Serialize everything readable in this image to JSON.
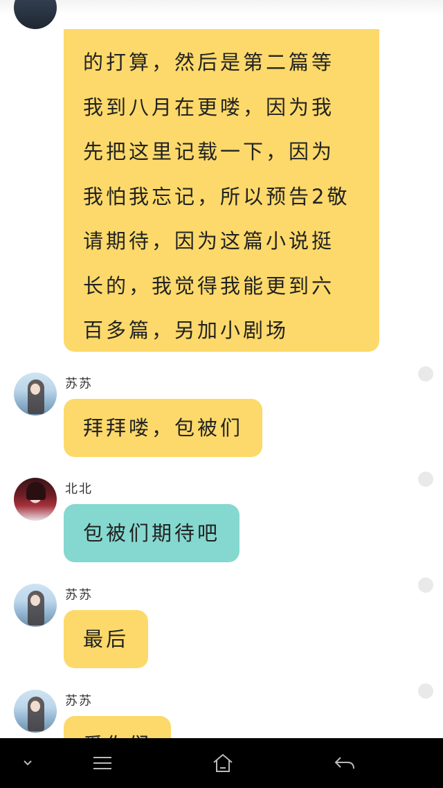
{
  "messages": [
    {
      "sender": "",
      "bubble_color": "#fcd96a",
      "lines": [
        "的打算，然后是第二篇等",
        "我到八月在更喽，因为我",
        "先把这里记载一下，因为",
        "我怕我忘记，所以预告2敬",
        "请期待，因为这篇小说挺",
        "长的，我觉得我能更到六",
        "百多篇，另加小剧场"
      ]
    },
    {
      "sender": "苏苏",
      "text": "拜拜喽，包被们",
      "bubble_color": "#fcd96a"
    },
    {
      "sender": "北北",
      "text": "包被们期待吧",
      "bubble_color": "#85d8cf"
    },
    {
      "sender": "苏苏",
      "text": "最后",
      "bubble_color": "#fcd96a"
    },
    {
      "sender": "苏苏",
      "text": "爱你们",
      "bubble_color": "#fcd96a"
    }
  ],
  "navbar": {
    "icons": [
      "chevron-down-icon",
      "menu-icon",
      "home-icon",
      "back-icon"
    ]
  }
}
